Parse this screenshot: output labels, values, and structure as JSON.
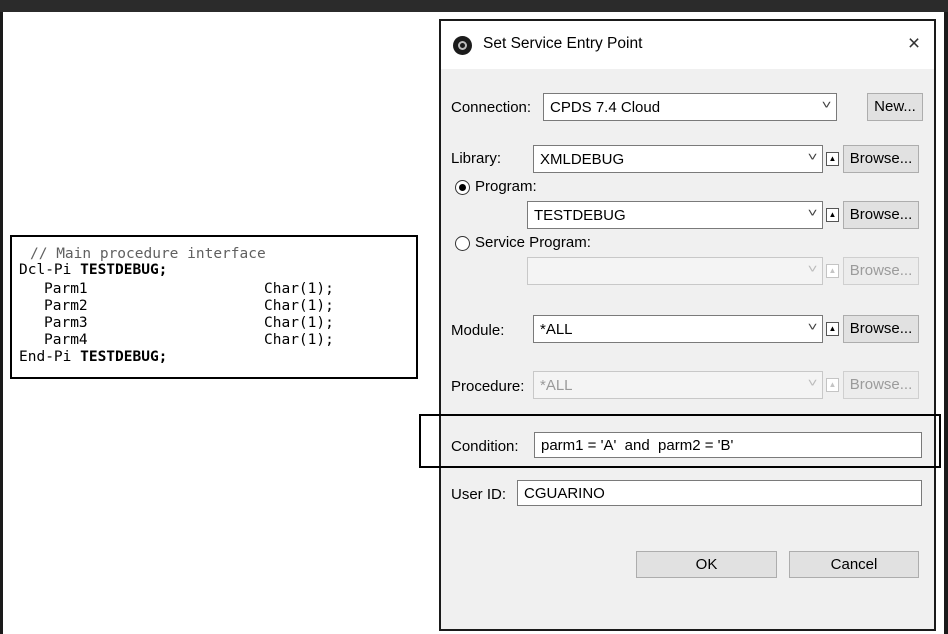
{
  "code": {
    "comment": "// Main procedure interface",
    "dcl_keyword": "Dcl-Pi ",
    "dcl_name": "TESTDEBUG;",
    "params": [
      {
        "name": "Parm1",
        "type": "Char(1);"
      },
      {
        "name": "Parm2",
        "type": "Char(1);"
      },
      {
        "name": "Parm3",
        "type": "Char(1);"
      },
      {
        "name": "Parm4",
        "type": "Char(1);"
      }
    ],
    "end_keyword": "End-Pi ",
    "end_name": "TESTDEBUG;"
  },
  "dialog": {
    "title": "Set Service Entry Point",
    "close_symbol": "×",
    "connection": {
      "label": "Connection:",
      "value": "CPDS 7.4 Cloud",
      "new_button": "New..."
    },
    "library": {
      "label": "Library:",
      "value": "XMLDEBUG",
      "browse": "Browse..."
    },
    "program": {
      "label": "Program:",
      "selected": true,
      "value": "TESTDEBUG",
      "browse": "Browse..."
    },
    "service_program": {
      "label": "Service Program:",
      "selected": false,
      "value": "",
      "browse": "Browse..."
    },
    "module": {
      "label": "Module:",
      "value": "*ALL",
      "browse": "Browse..."
    },
    "procedure": {
      "label": "Procedure:",
      "value": "*ALL",
      "browse": "Browse..."
    },
    "condition": {
      "label": "Condition:",
      "value": "parm1 = 'A'  and  parm2 = 'B'"
    },
    "user_id": {
      "label": "User ID:",
      "value": "CGUARINO"
    },
    "ok_button": "OK",
    "cancel_button": "Cancel"
  },
  "icons": {
    "app_icon": "disc-icon",
    "close_icon": "close-icon",
    "dropdown_icon": "chevron-down-icon",
    "history_icon": "triangle-up-icon"
  }
}
